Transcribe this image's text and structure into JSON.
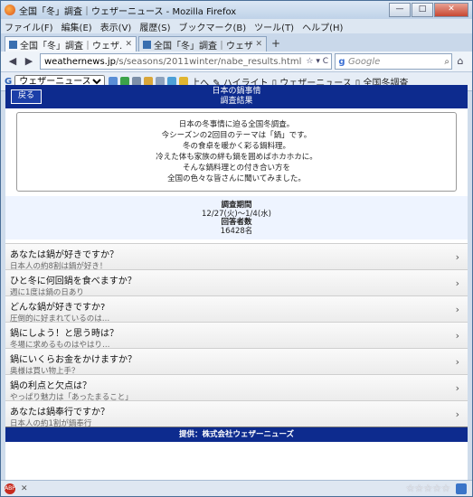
{
  "window": {
    "title": "全国「冬」調査｜ウェザーニュース - Mozilla Firefox",
    "minimize": "—",
    "maximize": "□",
    "close": "✕"
  },
  "menu": [
    "ファイル(F)",
    "編集(E)",
    "表示(V)",
    "履歴(S)",
    "ブックマーク(B)",
    "ツール(T)",
    "ヘルプ(H)"
  ],
  "tabs": [
    {
      "label": "全国「冬」調査｜ウェザ...",
      "close": "✕"
    },
    {
      "label": "全国「冬」調査｜ウェザー...",
      "close": "✕"
    }
  ],
  "new_tab": "+",
  "nav": {
    "back": "◀",
    "forward": "▶",
    "url_domain": "weathernews.jp",
    "url_path": "/s/seasons/2011winter/nabe_results.html",
    "url_icons": "☆ ▾ C",
    "search_placeholder": "Google",
    "search_engine": "g",
    "search_icon": "⌕",
    "home": "⌂"
  },
  "bookmarks": {
    "g_mark": "G",
    "dropdown_value": "ウェザーニュース 全国",
    "up": "上へ",
    "highlight": "ハイライト",
    "link1": "ウェザーニュース",
    "link2": "全国冬調査"
  },
  "page": {
    "back_button": "戻る",
    "header_line1": "日本の鍋事情",
    "header_line2": "調査結果",
    "intro": [
      "日本の冬事情に迫る全国冬調査。",
      "今シーズンの2回目のテーマは「鍋」です。",
      "冬の食卓を暖かく彩る鍋料理。",
      "冷えた体も家族の絆も鍋を囲めばホカホカに。",
      "そんな鍋料理との付き合い方を",
      "全国の色々な皆さんに聞いてみました。"
    ],
    "period_label": "調査期間",
    "period_value": "12/27(火)〜1/4(水)",
    "count_label": "回答者数",
    "count_value": "16428名",
    "items": [
      {
        "q": "あなたは鍋が好きですか？",
        "s": "日本人の約8割は鍋が好き！"
      },
      {
        "q": "ひと冬に何回鍋を食べますか？",
        "s": "週に1度は鍋の日あり"
      },
      {
        "q": "どんな鍋が好きですか?",
        "s": "圧倒的に好まれているのは…"
      },
      {
        "q": "鍋にしよう！と思う時は？",
        "s": "冬場に求めるものはやはり…"
      },
      {
        "q": "鍋にいくらお金をかけますか？",
        "s": "奥様は買い物上手？"
      },
      {
        "q": "鍋の利点と欠点は？",
        "s": "やっぱり魅力は「あったまること」"
      },
      {
        "q": "あなたは鍋奉行ですか？",
        "s": "日本人の約1割が鍋奉行"
      }
    ],
    "chevron": "›",
    "footer": "提供：株式会社ウェザーニューズ"
  },
  "status": {
    "abp": "ABP",
    "close": "✕",
    "stars": "☆☆☆☆☆"
  }
}
